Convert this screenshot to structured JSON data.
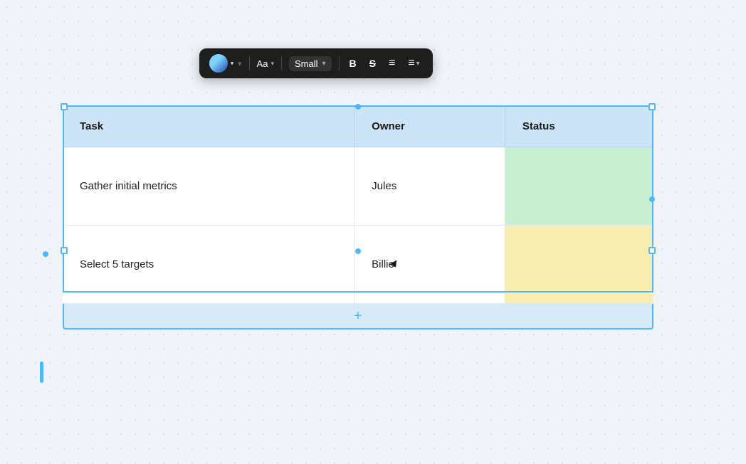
{
  "toolbar": {
    "color_label": "color-picker",
    "font_label": "Aa",
    "font_arrow": "▾",
    "size_label": "Small",
    "size_arrow": "▾",
    "bold_label": "B",
    "strikethrough_label": "S",
    "list_label": "≡",
    "align_label": "≡",
    "align_arrow": "▾"
  },
  "table": {
    "headers": [
      "Task",
      "Owner",
      "Status"
    ],
    "rows": [
      {
        "task": "Gather initial metrics",
        "owner": "Jules",
        "status": "",
        "status_color": "#c8f0d0"
      },
      {
        "task": "Select 5 targets",
        "owner": "Billie",
        "status": "",
        "status_color": "#faedb0"
      }
    ],
    "add_row_label": "+"
  },
  "cursor": {
    "visible": true
  },
  "left_indicator": {
    "dot_visible": true,
    "bar_visible": true
  }
}
